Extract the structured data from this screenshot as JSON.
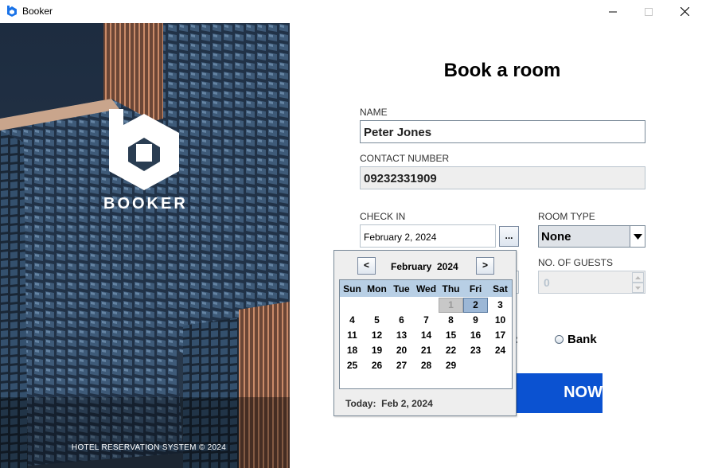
{
  "window": {
    "title": "Booker",
    "controls": [
      "minimize",
      "maximize",
      "close"
    ]
  },
  "hero": {
    "brand_name": "BOOKER",
    "footer": "HOTEL RESERVATION SYSTEM © 2024"
  },
  "form": {
    "title": "Book a room",
    "name_label": "NAME",
    "name_value": "Peter Jones",
    "contact_label": "CONTACT NUMBER",
    "contact_value": "09232331909",
    "checkin_label": "CHECK IN",
    "checkin_value": "February 2, 2024",
    "date_button_label": "...",
    "room_type_label": "ROOM TYPE",
    "room_type_value": "None",
    "guests_label": "NO. OF GUESTS",
    "guests_value": "0",
    "payment_partial": ":",
    "payment_option_bank": "Bank",
    "book_button_partial": "NOW"
  },
  "calendar": {
    "prev_label": "<",
    "next_label": ">",
    "month": "February",
    "year": "2024",
    "weekdays": [
      "Sun",
      "Mon",
      "Tue",
      "Wed",
      "Thu",
      "Fri",
      "Sat"
    ],
    "weeks": [
      [
        "",
        "",
        "",
        "",
        "1",
        "2",
        "3"
      ],
      [
        "4",
        "5",
        "6",
        "7",
        "8",
        "9",
        "10"
      ],
      [
        "11",
        "12",
        "13",
        "14",
        "15",
        "16",
        "17"
      ],
      [
        "18",
        "19",
        "20",
        "21",
        "22",
        "23",
        "24"
      ],
      [
        "25",
        "26",
        "27",
        "28",
        "29",
        "",
        ""
      ]
    ],
    "selected_day": "2",
    "other_month_day": "1",
    "today_label": "Today:",
    "today_value": "Feb 2, 2024"
  },
  "colors": {
    "accent": "#0b52d1",
    "calendar_header": "#b8cfe5",
    "selected_day": "#9cb7d6"
  }
}
